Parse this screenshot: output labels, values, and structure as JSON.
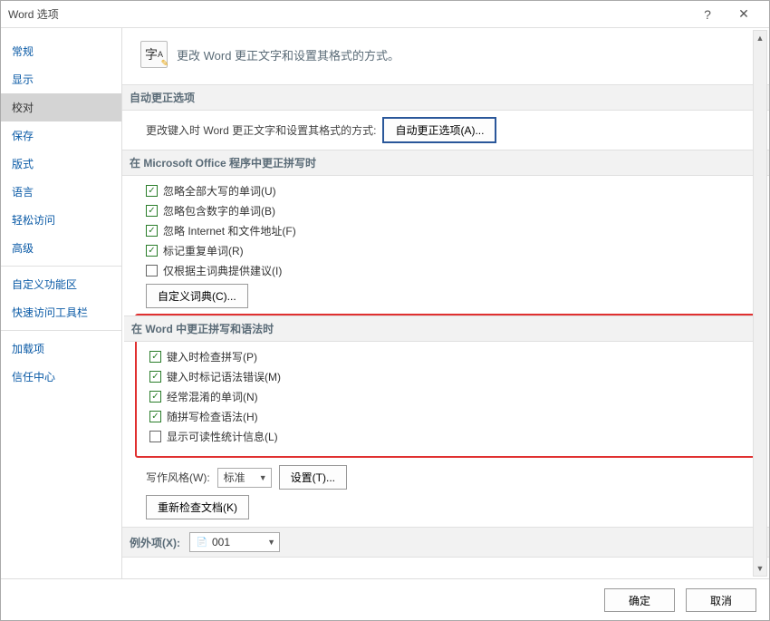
{
  "title": "Word 选项",
  "sidebar": {
    "items": [
      {
        "label": "常规"
      },
      {
        "label": "显示"
      },
      {
        "label": "校对"
      },
      {
        "label": "保存"
      },
      {
        "label": "版式"
      },
      {
        "label": "语言"
      },
      {
        "label": "轻松访问"
      },
      {
        "label": "高级"
      },
      {
        "label": "自定义功能区"
      },
      {
        "label": "快速访问工具栏"
      },
      {
        "label": "加载项"
      },
      {
        "label": "信任中心"
      }
    ],
    "active_index": 2
  },
  "header_text": "更改 Word 更正文字和设置其格式的方式。",
  "autocorrect": {
    "section_title": "自动更正选项",
    "desc": "更改键入时 Word 更正文字和设置其格式的方式:",
    "btn": "自动更正选项(A)..."
  },
  "office_spell": {
    "section_title": "在 Microsoft Office 程序中更正拼写时",
    "items": [
      {
        "label": "忽略全部大写的单词(U)",
        "checked": true
      },
      {
        "label": "忽略包含数字的单词(B)",
        "checked": true
      },
      {
        "label": "忽略 Internet 和文件地址(F)",
        "checked": true
      },
      {
        "label": "标记重复单词(R)",
        "checked": true
      },
      {
        "label": "仅根据主词典提供建议(I)",
        "checked": false
      }
    ],
    "dict_btn": "自定义词典(C)..."
  },
  "word_spell": {
    "section_title": "在 Word 中更正拼写和语法时",
    "items": [
      {
        "label": "键入时检查拼写(P)",
        "checked": true
      },
      {
        "label": "键入时标记语法错误(M)",
        "checked": true
      },
      {
        "label": "经常混淆的单词(N)",
        "checked": true
      },
      {
        "label": "随拼写检查语法(H)",
        "checked": true
      },
      {
        "label": "显示可读性统计信息(L)",
        "checked": false
      }
    ],
    "style_label": "写作风格(W):",
    "style_value": "标准",
    "settings_btn": "设置(T)...",
    "recheck_btn": "重新检查文档(K)"
  },
  "exceptions": {
    "section_title": "例外项(X):",
    "value": "001"
  },
  "footer": {
    "ok": "确定",
    "cancel": "取消"
  }
}
